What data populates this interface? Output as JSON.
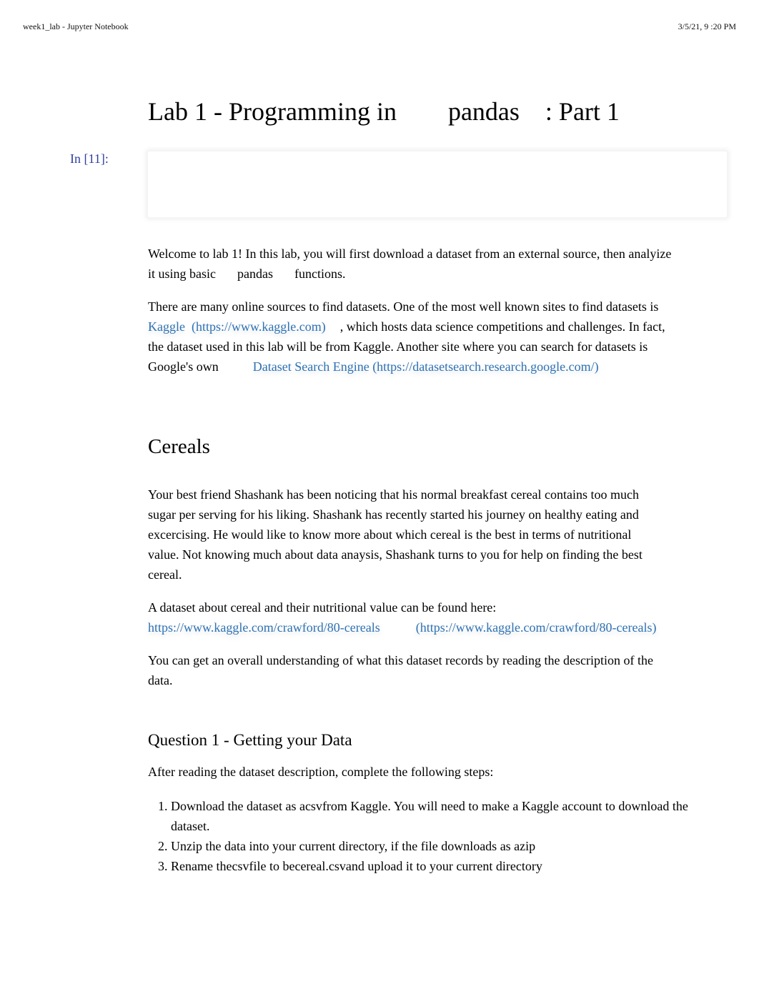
{
  "print_header": {
    "page_title": "week1_lab - Jupyter Notebook",
    "datetime": "3/5/21, 9  :20 PM"
  },
  "notebook": {
    "title": {
      "part1": "Lab 1 - Programming in",
      "code": "pandas",
      "part2": ": Part 1"
    },
    "code_cell": {
      "prompt": "In [11]:",
      "source": ""
    },
    "intro": {
      "p1_a": "Welcome to lab 1! In this lab, you will first download a dataset from an external source, then analyize it using basic",
      "p1_code": "pandas",
      "p1_b": "functions.",
      "p2_a": "There are many online sources to find datasets. One of the most well known sites to find datasets is",
      "kaggle_link_text": "Kaggle",
      "kaggle_link_url": "(https://www.kaggle.com)",
      "p2_b": ", which hosts data science competitions and challenges. In fact, the dataset used in this lab will be from Kaggle. Another site where you can search for datasets is Google's own",
      "dse_link_text": "Dataset Search Engine",
      "dse_link_url": "(https://datasetsearch.research.google.com/)"
    },
    "cereals": {
      "heading": "Cereals",
      "p1": "Your best friend Shashank has been noticing that his normal breakfast cereal contains too much sugar per serving for his liking. Shashank has recently started his journey on healthy eating and excercising. He would like to know more about which cereal is the best in terms of nutritional value. Not knowing much about data anaysis, Shashank turns to you for help on finding the best cereal.",
      "p2": "A dataset about cereal and their nutritional value can be found here:",
      "dataset_link_text": "https://www.kaggle.com/crawford/80-cereals",
      "dataset_link_url": "(https://www.kaggle.com/crawford/80-cereals)",
      "p3": "You can get an overall understanding of what this dataset records by reading the description of the data."
    },
    "question1": {
      "heading": "Question 1 - Getting your Data",
      "intro": "After reading the dataset description, complete the following steps:",
      "steps": [
        {
          "a": "Download the dataset as a",
          "code": "csv",
          "b": "from Kaggle. You will need to make a Kaggle account to download the dataset."
        },
        {
          "a": "Unzip the data into your current directory, if the file downloads as a",
          "code": "zip",
          "b": ""
        },
        {
          "a": "Rename  the",
          "code": "csv",
          "b": "file to be",
          "code2": "cereal.csv",
          "c": "and upload it to your current directory"
        }
      ]
    }
  }
}
